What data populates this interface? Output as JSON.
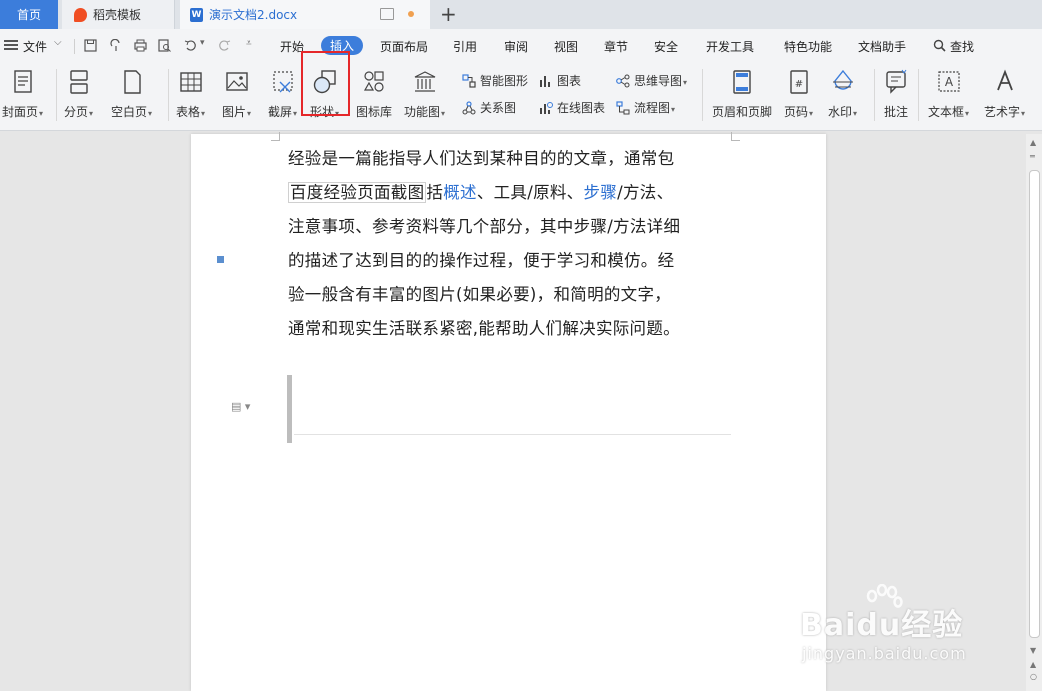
{
  "tabs": {
    "home": "首页",
    "templates": "稻壳模板",
    "document": "演示文档2.docx"
  },
  "menu": {
    "file": "文件",
    "items": [
      "开始",
      "插入",
      "页面布局",
      "引用",
      "审阅",
      "视图",
      "章节",
      "安全",
      "开发工具",
      "特色功能",
      "文档助手"
    ],
    "search": "查找",
    "active": "插入"
  },
  "ribbon": {
    "cover": "封面页",
    "pagebreak": "分页",
    "blankpage": "空白页",
    "table": "表格",
    "picture": "图片",
    "screenshot": "截屏",
    "shape": "形状",
    "iconlib": "图标库",
    "funcchart": "功能图",
    "smartart": "智能图形",
    "chart": "图表",
    "mindmap": "思维导图",
    "relation": "关系图",
    "onlinechart": "在线图表",
    "flowchart": "流程图",
    "headerfooter": "页眉和页脚",
    "pagenum": "页码",
    "watermark": "水印",
    "comment": "批注",
    "textbox": "文本框",
    "wordart": "艺术字"
  },
  "document": {
    "line1": "经验是一篇能指导人们达到某种目的的文章，通常包",
    "overlay": "百度经验页面截图",
    "line2_a": "括",
    "line2_link1": "概述",
    "line2_b": "、工具/原料、",
    "line2_link2": "步骤",
    "line2_c": "/方法、",
    "line3": "注意事项、参考资料等几个部分，其中步骤/方法详细",
    "line4": "的描述了达到目的的操作过程，便于学习和模仿。经",
    "line5": "验一般含有丰富的图片(如果必要)，和简明的文字，",
    "line6": "通常和现实生活联系紧密,能帮助人们解决实际问题。"
  },
  "watermark": {
    "brand": "Baidu经验",
    "url": "jingyan.baidu.com"
  },
  "colors": {
    "accent": "#3c7ddb",
    "highlight": "#e5272a",
    "link": "#2c6fd1"
  }
}
